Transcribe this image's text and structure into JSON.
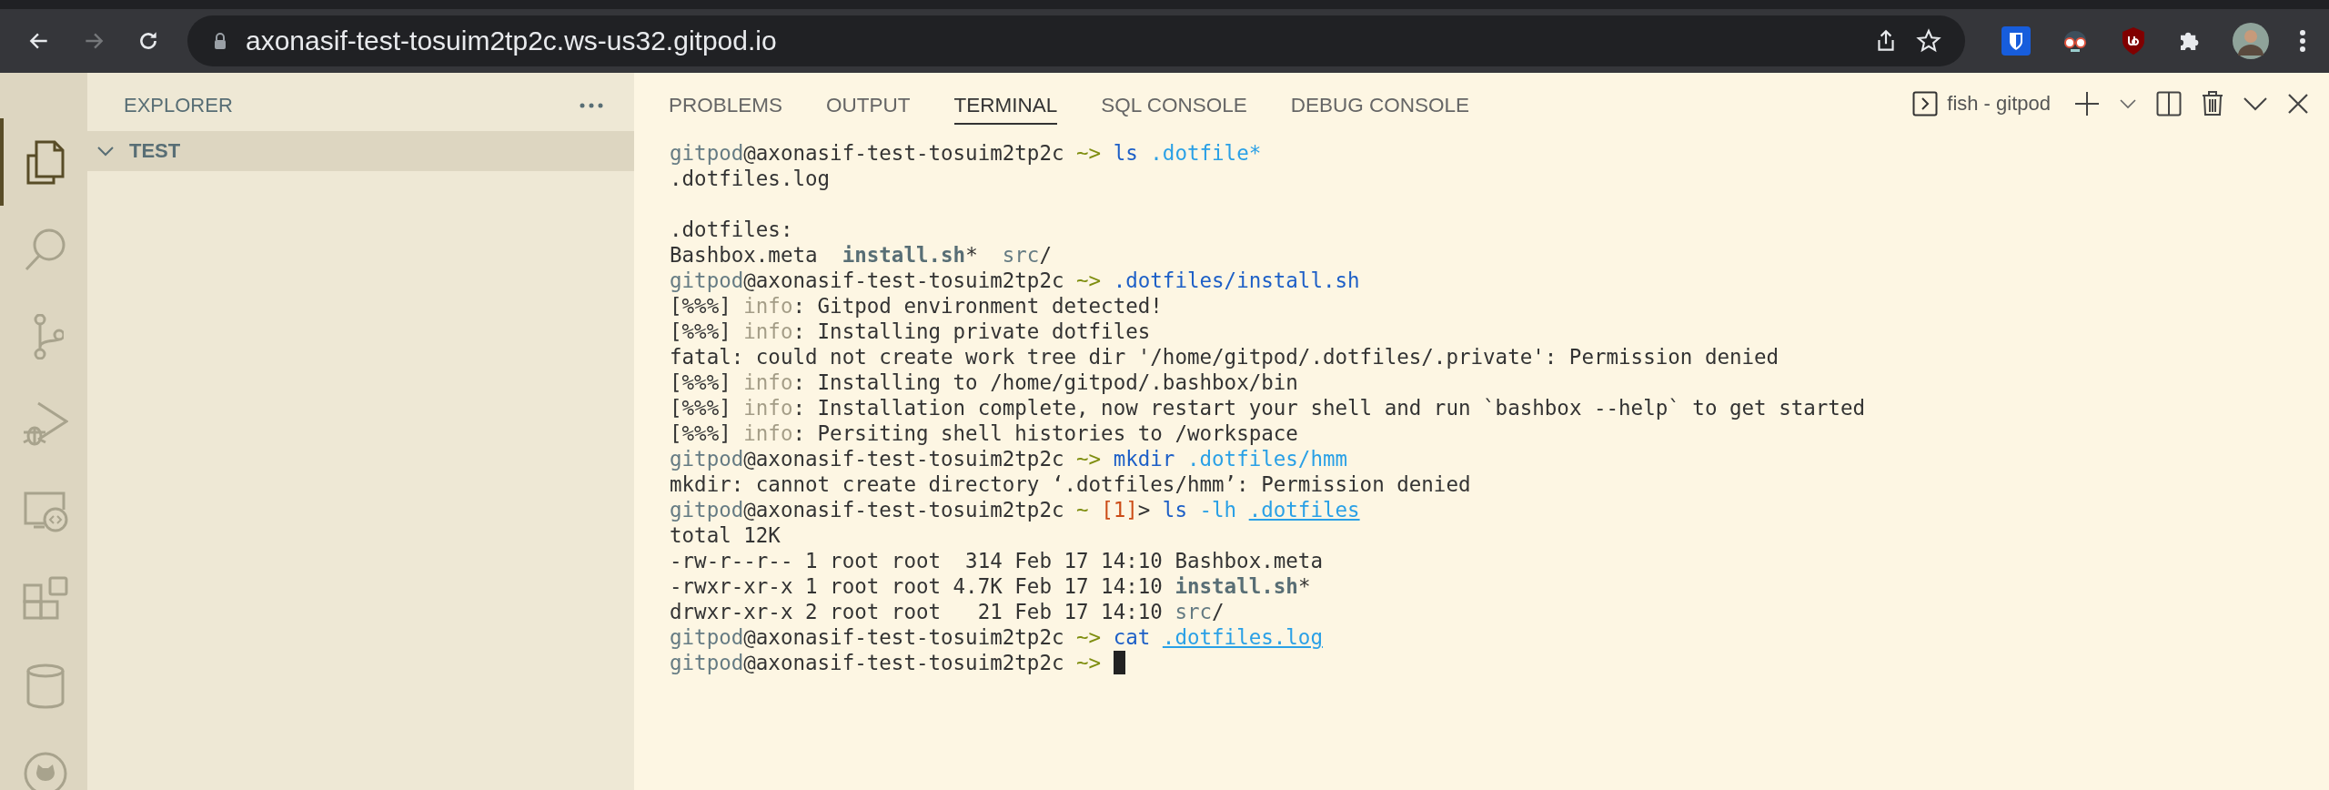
{
  "browser": {
    "url": "axonasif-test-tosuim2tp2c.ws-us32.gitpod.io"
  },
  "activity_bar": [
    {
      "kind": "files",
      "selected": true
    },
    {
      "kind": "search",
      "selected": false
    },
    {
      "kind": "source-control",
      "selected": false
    },
    {
      "kind": "run-debug",
      "selected": false
    },
    {
      "kind": "remote",
      "selected": false
    },
    {
      "kind": "extensions",
      "selected": false
    },
    {
      "kind": "database",
      "selected": false
    },
    {
      "kind": "github",
      "selected": false
    }
  ],
  "explorer": {
    "title": "EXPLORER",
    "folders": [
      {
        "name": "TEST",
        "expanded": true
      }
    ]
  },
  "panel": {
    "tabs": [
      {
        "label": "PROBLEMS",
        "selected": false
      },
      {
        "label": "OUTPUT",
        "selected": false
      },
      {
        "label": "TERMINAL",
        "selected": true
      },
      {
        "label": "SQL CONSOLE",
        "selected": false
      },
      {
        "label": "DEBUG CONSOLE",
        "selected": false
      }
    ],
    "terminal_name": "fish - gitpod"
  },
  "terminal": {
    "lines": [
      {
        "kind": "text",
        "segments": [
          {
            "t": "gitpod",
            "kind": "user"
          },
          {
            "t": "@axonasif-test-tosuim2tp2c ",
            "kind": "plain"
          },
          {
            "t": "~>",
            "kind": "tilde"
          },
          {
            "t": " ls",
            "kind": "cmd"
          },
          {
            "t": " .dotfile*",
            "kind": "arg"
          }
        ]
      },
      {
        "kind": "text",
        "segments": [
          {
            "t": ".dotfiles.log",
            "kind": "plain"
          }
        ]
      },
      {
        "kind": "blank"
      },
      {
        "kind": "text",
        "segments": [
          {
            "t": ".dotfiles:",
            "kind": "plain"
          }
        ]
      },
      {
        "kind": "text",
        "segments": [
          {
            "t": "Bashbox.meta  ",
            "kind": "plain"
          },
          {
            "t": "install.sh",
            "kind": "bold"
          },
          {
            "t": "*  ",
            "kind": "plain"
          },
          {
            "t": "src",
            "kind": "dir"
          },
          {
            "t": "/",
            "kind": "plain"
          }
        ]
      },
      {
        "kind": "text",
        "segments": [
          {
            "t": "gitpod",
            "kind": "user"
          },
          {
            "t": "@axonasif-test-tosuim2tp2c ",
            "kind": "plain"
          },
          {
            "t": "~>",
            "kind": "tilde"
          },
          {
            "t": " .dotfiles/install.sh",
            "kind": "cmd"
          }
        ]
      },
      {
        "kind": "text",
        "segments": [
          {
            "t": "[%%%] ",
            "kind": "plain"
          },
          {
            "t": "info",
            "kind": "faint"
          },
          {
            "t": ": Gitpod environment detected!",
            "kind": "plain"
          }
        ]
      },
      {
        "kind": "text",
        "segments": [
          {
            "t": "[%%%] ",
            "kind": "plain"
          },
          {
            "t": "info",
            "kind": "faint"
          },
          {
            "t": ": Installing private dotfiles",
            "kind": "plain"
          }
        ]
      },
      {
        "kind": "text",
        "segments": [
          {
            "t": "fatal: could not create work tree dir '/home/gitpod/.dotfiles/.private': Permission denied",
            "kind": "plain"
          }
        ]
      },
      {
        "kind": "text",
        "segments": [
          {
            "t": "[%%%] ",
            "kind": "plain"
          },
          {
            "t": "info",
            "kind": "faint"
          },
          {
            "t": ": Installing to /home/gitpod/.bashbox/bin",
            "kind": "plain"
          }
        ]
      },
      {
        "kind": "text",
        "segments": [
          {
            "t": "[%%%] ",
            "kind": "plain"
          },
          {
            "t": "info",
            "kind": "faint"
          },
          {
            "t": ": Installation complete, now restart your shell and run `bashbox --help` to get started",
            "kind": "plain"
          }
        ]
      },
      {
        "kind": "text",
        "segments": [
          {
            "t": "[%%%] ",
            "kind": "plain"
          },
          {
            "t": "info",
            "kind": "faint"
          },
          {
            "t": ": Persiting shell histories to /workspace",
            "kind": "plain"
          }
        ]
      },
      {
        "kind": "text",
        "segments": [
          {
            "t": "gitpod",
            "kind": "user"
          },
          {
            "t": "@axonasif-test-tosuim2tp2c ",
            "kind": "plain"
          },
          {
            "t": "~>",
            "kind": "tilde"
          },
          {
            "t": " mkdir",
            "kind": "cmd"
          },
          {
            "t": " .dotfiles/hmm",
            "kind": "arg"
          }
        ]
      },
      {
        "kind": "text",
        "segments": [
          {
            "t": "mkdir: cannot create directory ‘.dotfiles/hmm’: Permission denied",
            "kind": "plain"
          }
        ]
      },
      {
        "kind": "text",
        "segments": [
          {
            "t": "gitpod",
            "kind": "user"
          },
          {
            "t": "@axonasif-test-tosuim2tp2c ",
            "kind": "plain"
          },
          {
            "t": "~ ",
            "kind": "tilde"
          },
          {
            "t": "[1]",
            "kind": "status"
          },
          {
            "t": "> ",
            "kind": "plain"
          },
          {
            "t": "ls ",
            "kind": "cmd"
          },
          {
            "t": "-lh ",
            "kind": "arg"
          },
          {
            "t": ".dotfiles",
            "kind": "path"
          }
        ]
      },
      {
        "kind": "text",
        "segments": [
          {
            "t": "total 12K",
            "kind": "plain"
          }
        ]
      },
      {
        "kind": "text",
        "segments": [
          {
            "t": "-rw-r--r-- 1 root root  314 Feb 17 14:10 Bashbox.meta",
            "kind": "plain"
          }
        ]
      },
      {
        "kind": "text",
        "segments": [
          {
            "t": "-rwxr-xr-x 1 root root 4.7K Feb 17 14:10 ",
            "kind": "plain"
          },
          {
            "t": "install.sh",
            "kind": "bold"
          },
          {
            "t": "*",
            "kind": "plain"
          }
        ]
      },
      {
        "kind": "text",
        "segments": [
          {
            "t": "drwxr-xr-x 2 root root   21 Feb 17 14:10 ",
            "kind": "plain"
          },
          {
            "t": "src",
            "kind": "dir"
          },
          {
            "t": "/",
            "kind": "plain"
          }
        ]
      },
      {
        "kind": "text",
        "segments": [
          {
            "t": "gitpod",
            "kind": "user"
          },
          {
            "t": "@axonasif-test-tosuim2tp2c ",
            "kind": "plain"
          },
          {
            "t": "~>",
            "kind": "tilde"
          },
          {
            "t": " cat ",
            "kind": "cmd"
          },
          {
            "t": ".dotfiles.log",
            "kind": "path"
          }
        ]
      },
      {
        "kind": "text",
        "cursor": true,
        "segments": [
          {
            "t": "gitpod",
            "kind": "user"
          },
          {
            "t": "@axonasif-test-tosuim2tp2c ",
            "kind": "plain"
          },
          {
            "t": "~>",
            "kind": "tilde"
          }
        ]
      }
    ]
  }
}
